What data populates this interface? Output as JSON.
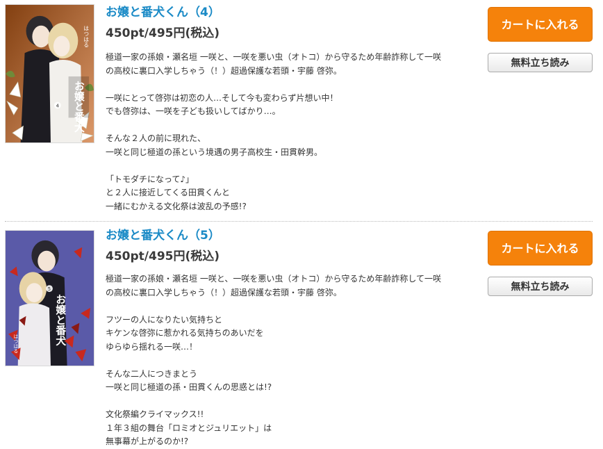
{
  "items": [
    {
      "title": "お嬢と番犬くん（4）",
      "price": "450pt/495円(税込)",
      "cart_label": "カートに入れる",
      "read_label": "無料立ち読み",
      "cover": {
        "author": "はつはる",
        "series_text": "お嬢と番犬",
        "volume": "4",
        "background_color": "#c9621a"
      },
      "description": [
        "極道一家の孫娘・瀬名垣 一咲と、一咲を悪い虫（オトコ）から守るため年齢詐称して一咲",
        "の高校に裏口入学しちゃう（！）超過保護な若頭・宇藤 啓弥。",
        "",
        "一咲にとって啓弥は初恋の人…そして今も変わらず片想い中！",
        "でも啓弥は、一咲を子ども扱いしてばかり…。",
        "",
        "そんな２人の前に現れた、",
        "一咲と同じ極道の孫という境遇の男子高校生・田貫幹男。",
        "",
        "「トモダチになって♪」",
        "と２人に接近してくる田貫くんと",
        "一緒にむかえる文化祭は波乱の予感!?"
      ]
    },
    {
      "title": "お嬢と番犬くん（5）",
      "price": "450pt/495円(税込)",
      "cart_label": "カートに入れる",
      "read_label": "無料立ち読み",
      "cover": {
        "author": "はつはる",
        "series_text": "お嬢と番犬",
        "volume": "5",
        "background_color": "#5a5aa8"
      },
      "description": [
        "極道一家の孫娘・瀬名垣 一咲と、一咲を悪い虫（オトコ）から守るため年齢詐称して一咲",
        "の高校に裏口入学しちゃう（！）超過保護な若頭・宇藤 啓弥。",
        "",
        "フツーの人になりたい気持ちと",
        "キケンな啓弥に惹かれる気持ちのあいだを",
        "ゆらゆら揺れる一咲…！",
        "",
        "そんな二人につきまとう",
        "一咲と同じ極道の孫・田貫くんの思惑とは!?",
        "",
        "文化祭編クライマックス!!",
        "１年３組の舞台「ロミオとジュリエット」は",
        "無事幕が上がるのか!?"
      ]
    }
  ],
  "colors": {
    "title": "#1a8ac6",
    "cart_button": "#f5820b",
    "text": "#333333"
  }
}
